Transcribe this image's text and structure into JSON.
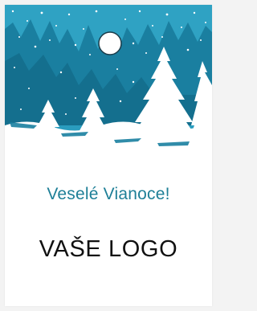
{
  "card": {
    "greeting": "Veselé Vianoce!",
    "logo_placeholder": "VAŠE LOGO"
  },
  "scene": {
    "sky_color": "#2a9cbe",
    "far_tree_color": "#1a7fa0",
    "snow_color": "#ffffff",
    "moon_icon": "moon-icon"
  },
  "colors": {
    "greeting_text": "#1e7f97",
    "logo_text": "#111111",
    "page_background": "#f3f3f3"
  }
}
